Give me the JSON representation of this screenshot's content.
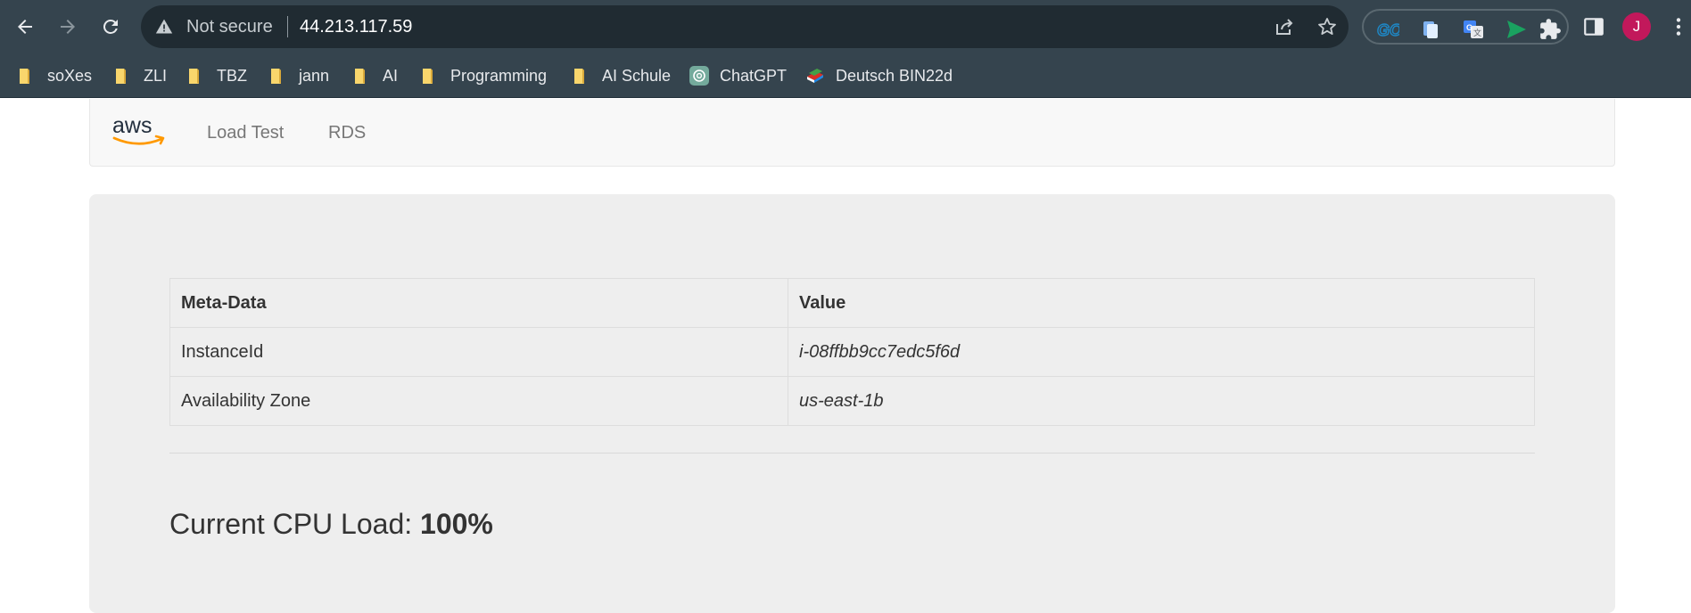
{
  "browser": {
    "security_label": "Not secure",
    "url": "44.213.117.59",
    "profile_initial": "J"
  },
  "bookmarks": [
    {
      "label": "soXes",
      "icon": "folder-icon"
    },
    {
      "label": "ZLI",
      "icon": "folder-icon"
    },
    {
      "label": "TBZ",
      "icon": "folder-icon"
    },
    {
      "label": "jann",
      "icon": "folder-icon"
    },
    {
      "label": "AI",
      "icon": "folder-icon"
    },
    {
      "label": "Programming",
      "icon": "folder-icon"
    },
    {
      "label": "AI Schule",
      "icon": "folder-icon"
    },
    {
      "label": "ChatGPT",
      "icon": "chatgpt-icon"
    },
    {
      "label": "Deutsch BIN22d",
      "icon": "books-icon"
    }
  ],
  "navbar": {
    "brand": "aws",
    "links": [
      "Load Test",
      "RDS"
    ]
  },
  "table": {
    "headers": [
      "Meta-Data",
      "Value"
    ],
    "rows": [
      {
        "key": "InstanceId",
        "value": "i-08ffbb9cc7edc5f6d"
      },
      {
        "key": "Availability Zone",
        "value": "us-east-1b"
      }
    ]
  },
  "cpu": {
    "label": "Current CPU Load: ",
    "value": "100%"
  },
  "colors": {
    "chrome_bg": "#35444e",
    "omnibox_bg": "#202b32",
    "aws_orange": "#ff9900",
    "jumbotron_bg": "#eeeeee",
    "avatar": "#c2185b"
  }
}
